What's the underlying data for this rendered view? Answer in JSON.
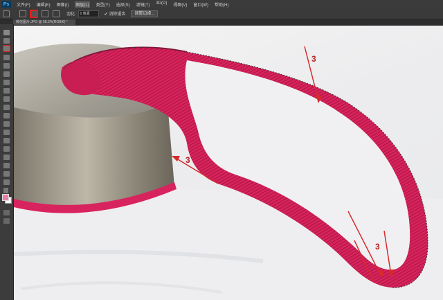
{
  "app": {
    "logo": "Ps"
  },
  "menubar": {
    "items": [
      "文件(F)",
      "编辑(E)",
      "图像(I)",
      "图层(L)",
      "类型(Y)",
      "选择(S)",
      "滤镜(T)",
      "3D(D)",
      "视图(V)",
      "窗口(W)",
      "帮助(H)"
    ],
    "active_index": 3
  },
  "options": {
    "feather_label": "羽化:",
    "feather_value": "0 像素",
    "antialias_label": "消除锯齿",
    "refine_button": "调整边缘..."
  },
  "document": {
    "tab_title": "微信图片.JPG @ 58.3%(RGB/8) *"
  },
  "annotations": [
    {
      "label": "3"
    },
    {
      "label": "3"
    },
    {
      "label": "3"
    }
  ],
  "colors": {
    "ribbon": "#d8245e",
    "ribbon_dark": "#a3103e",
    "annotation": "#d72a2a",
    "foreground_swatch": "#e87fa8",
    "selection_highlight": "#e02020"
  }
}
